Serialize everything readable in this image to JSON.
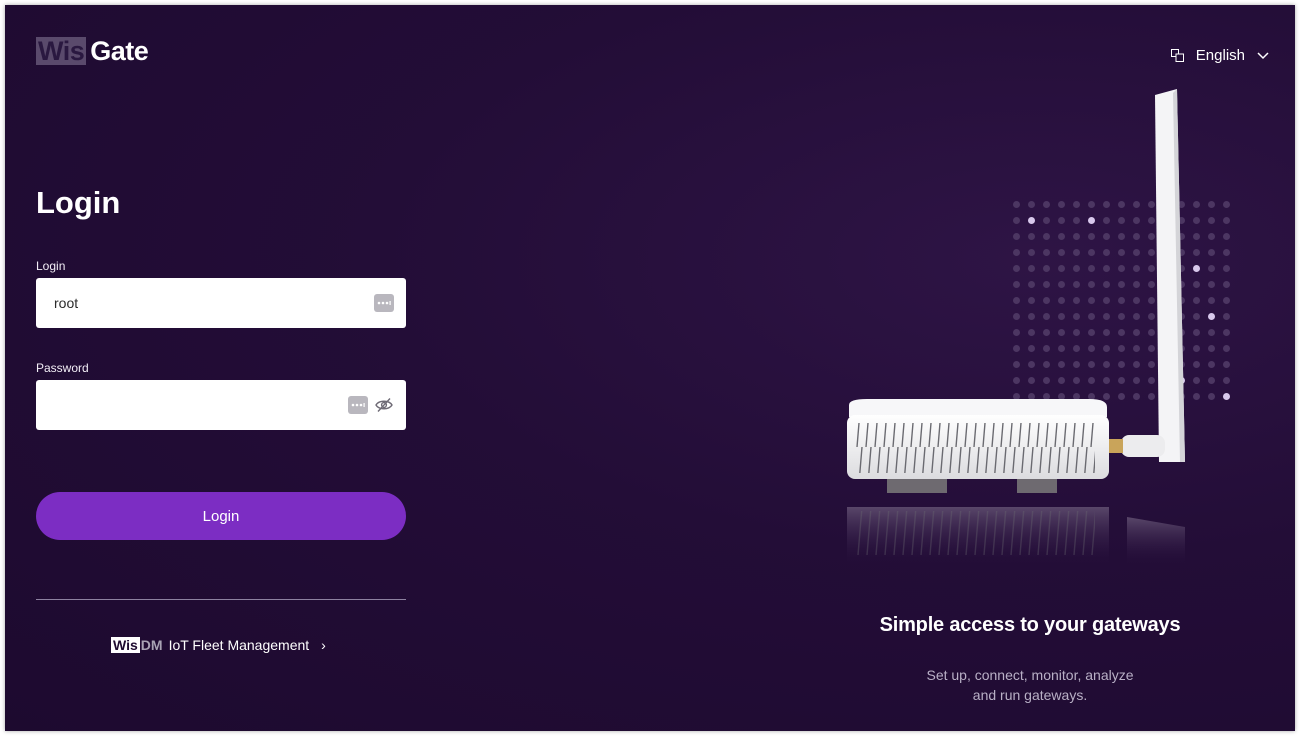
{
  "brand": {
    "logo_highlight": "Wis",
    "logo_rest": "Gate"
  },
  "language": {
    "icon": "language-icon",
    "selected": "English",
    "chevron": "chevron-down-icon"
  },
  "form": {
    "title": "Login",
    "login_label": "Login",
    "login_value": "root",
    "password_label": "Password",
    "password_value": "",
    "submit_label": "Login"
  },
  "wisdm": {
    "logo_highlight": "Wis",
    "logo_rest": "DM",
    "label": "IoT Fleet Management",
    "chevron": "›"
  },
  "hero": {
    "tagline": "Simple access to your gateways",
    "subline_1": "Set up, connect, monitor, analyze",
    "subline_2": "and run gateways."
  },
  "colors": {
    "background": "#230d37",
    "accent": "#7c2dc3",
    "input_bg": "#ffffff",
    "muted_text": "#b9b0c6"
  }
}
